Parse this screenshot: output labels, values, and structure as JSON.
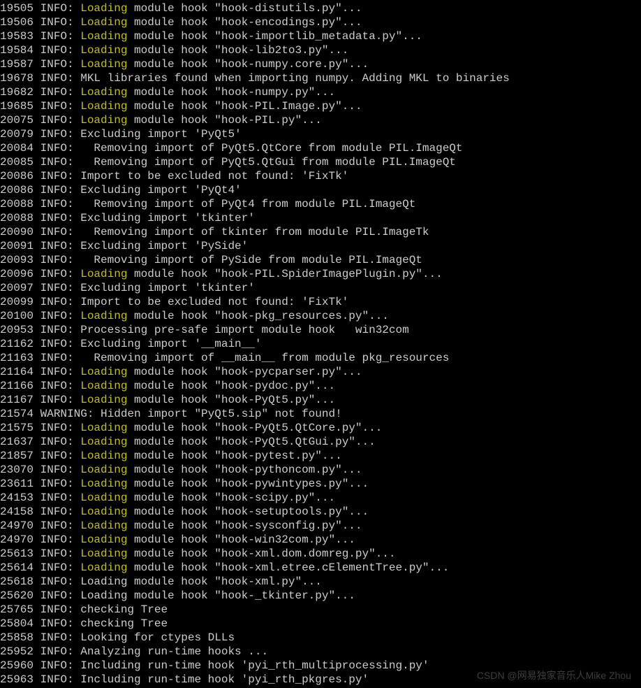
{
  "watermark": "CSDN @网易独家音乐人Mike Zhou",
  "log_lines": [
    {
      "ts": "19505",
      "lvl": "INFO",
      "loading": true,
      "rest": " module hook \"hook-distutils.py\"..."
    },
    {
      "ts": "19506",
      "lvl": "INFO",
      "loading": true,
      "rest": " module hook \"hook-encodings.py\"..."
    },
    {
      "ts": "19583",
      "lvl": "INFO",
      "loading": true,
      "rest": " module hook \"hook-importlib_metadata.py\"..."
    },
    {
      "ts": "19584",
      "lvl": "INFO",
      "loading": true,
      "rest": " module hook \"hook-lib2to3.py\"..."
    },
    {
      "ts": "19587",
      "lvl": "INFO",
      "loading": true,
      "rest": " module hook \"hook-numpy.core.py\"..."
    },
    {
      "ts": "19678",
      "lvl": "INFO",
      "loading": false,
      "rest": "MKL libraries found when importing numpy. Adding MKL to binaries"
    },
    {
      "ts": "19682",
      "lvl": "INFO",
      "loading": true,
      "rest": " module hook \"hook-numpy.py\"..."
    },
    {
      "ts": "19685",
      "lvl": "INFO",
      "loading": true,
      "rest": " module hook \"hook-PIL.Image.py\"..."
    },
    {
      "ts": "20075",
      "lvl": "INFO",
      "loading": true,
      "rest": " module hook \"hook-PIL.py\"..."
    },
    {
      "ts": "20079",
      "lvl": "INFO",
      "loading": false,
      "rest": "Excluding import 'PyQt5'"
    },
    {
      "ts": "20084",
      "lvl": "INFO",
      "loading": false,
      "rest": "  Removing import of PyQt5.QtCore from module PIL.ImageQt"
    },
    {
      "ts": "20085",
      "lvl": "INFO",
      "loading": false,
      "rest": "  Removing import of PyQt5.QtGui from module PIL.ImageQt"
    },
    {
      "ts": "20086",
      "lvl": "INFO",
      "loading": false,
      "rest": "Import to be excluded not found: 'FixTk'"
    },
    {
      "ts": "20086",
      "lvl": "INFO",
      "loading": false,
      "rest": "Excluding import 'PyQt4'"
    },
    {
      "ts": "20088",
      "lvl": "INFO",
      "loading": false,
      "rest": "  Removing import of PyQt4 from module PIL.ImageQt"
    },
    {
      "ts": "20088",
      "lvl": "INFO",
      "loading": false,
      "rest": "Excluding import 'tkinter'"
    },
    {
      "ts": "20090",
      "lvl": "INFO",
      "loading": false,
      "rest": "  Removing import of tkinter from module PIL.ImageTk"
    },
    {
      "ts": "20091",
      "lvl": "INFO",
      "loading": false,
      "rest": "Excluding import 'PySide'"
    },
    {
      "ts": "20093",
      "lvl": "INFO",
      "loading": false,
      "rest": "  Removing import of PySide from module PIL.ImageQt"
    },
    {
      "ts": "20096",
      "lvl": "INFO",
      "loading": true,
      "rest": " module hook \"hook-PIL.SpiderImagePlugin.py\"..."
    },
    {
      "ts": "20097",
      "lvl": "INFO",
      "loading": false,
      "rest": "Excluding import 'tkinter'"
    },
    {
      "ts": "20099",
      "lvl": "INFO",
      "loading": false,
      "rest": "Import to be excluded not found: 'FixTk'"
    },
    {
      "ts": "20100",
      "lvl": "INFO",
      "loading": true,
      "rest": " module hook \"hook-pkg_resources.py\"..."
    },
    {
      "ts": "20953",
      "lvl": "INFO",
      "loading": false,
      "rest": "Processing pre-safe import module hook   win32com"
    },
    {
      "ts": "21162",
      "lvl": "INFO",
      "loading": false,
      "rest": "Excluding import '__main__'"
    },
    {
      "ts": "21163",
      "lvl": "INFO",
      "loading": false,
      "rest": "  Removing import of __main__ from module pkg_resources"
    },
    {
      "ts": "21164",
      "lvl": "INFO",
      "loading": true,
      "rest": " module hook \"hook-pycparser.py\"..."
    },
    {
      "ts": "21166",
      "lvl": "INFO",
      "loading": true,
      "rest": " module hook \"hook-pydoc.py\"..."
    },
    {
      "ts": "21167",
      "lvl": "INFO",
      "loading": true,
      "rest": " module hook \"hook-PyQt5.py\"..."
    },
    {
      "ts": "21574",
      "lvl": "WARNING",
      "loading": false,
      "rest": "Hidden import \"PyQt5.sip\" not found!"
    },
    {
      "ts": "21575",
      "lvl": "INFO",
      "loading": true,
      "rest": " module hook \"hook-PyQt5.QtCore.py\"..."
    },
    {
      "ts": "21637",
      "lvl": "INFO",
      "loading": true,
      "rest": " module hook \"hook-PyQt5.QtGui.py\"..."
    },
    {
      "ts": "21857",
      "lvl": "INFO",
      "loading": true,
      "rest": " module hook \"hook-pytest.py\"..."
    },
    {
      "ts": "23070",
      "lvl": "INFO",
      "loading": true,
      "rest": " module hook \"hook-pythoncom.py\"..."
    },
    {
      "ts": "23611",
      "lvl": "INFO",
      "loading": true,
      "rest": " module hook \"hook-pywintypes.py\"..."
    },
    {
      "ts": "24153",
      "lvl": "INFO",
      "loading": true,
      "rest": " module hook \"hook-scipy.py\"..."
    },
    {
      "ts": "24158",
      "lvl": "INFO",
      "loading": true,
      "rest": " module hook \"hook-setuptools.py\"..."
    },
    {
      "ts": "24970",
      "lvl": "INFO",
      "loading": true,
      "rest": " module hook \"hook-sysconfig.py\"..."
    },
    {
      "ts": "24970",
      "lvl": "INFO",
      "loading": true,
      "rest": " module hook \"hook-win32com.py\"..."
    },
    {
      "ts": "25613",
      "lvl": "INFO",
      "loading": true,
      "rest": " module hook \"hook-xml.dom.domreg.py\"..."
    },
    {
      "ts": "25614",
      "lvl": "INFO",
      "loading": true,
      "rest": " module hook \"hook-xml.etree.cElementTree.py\"..."
    },
    {
      "ts": "25618",
      "lvl": "INFO",
      "loading": false,
      "rest": "Loading module hook \"hook-xml.py\"..."
    },
    {
      "ts": "25620",
      "lvl": "INFO",
      "loading": false,
      "rest": "Loading module hook \"hook-_tkinter.py\"..."
    },
    {
      "ts": "25765",
      "lvl": "INFO",
      "loading": false,
      "rest": "checking Tree"
    },
    {
      "ts": "25804",
      "lvl": "INFO",
      "loading": false,
      "rest": "checking Tree"
    },
    {
      "ts": "25858",
      "lvl": "INFO",
      "loading": false,
      "rest": "Looking for ctypes DLLs"
    },
    {
      "ts": "25952",
      "lvl": "INFO",
      "loading": false,
      "rest": "Analyzing run-time hooks ..."
    },
    {
      "ts": "25960",
      "lvl": "INFO",
      "loading": false,
      "rest": "Including run-time hook 'pyi_rth_multiprocessing.py'"
    },
    {
      "ts": "25963",
      "lvl": "INFO",
      "loading": false,
      "rest": "Including run-time hook 'pyi_rth_pkgres.py'"
    }
  ]
}
